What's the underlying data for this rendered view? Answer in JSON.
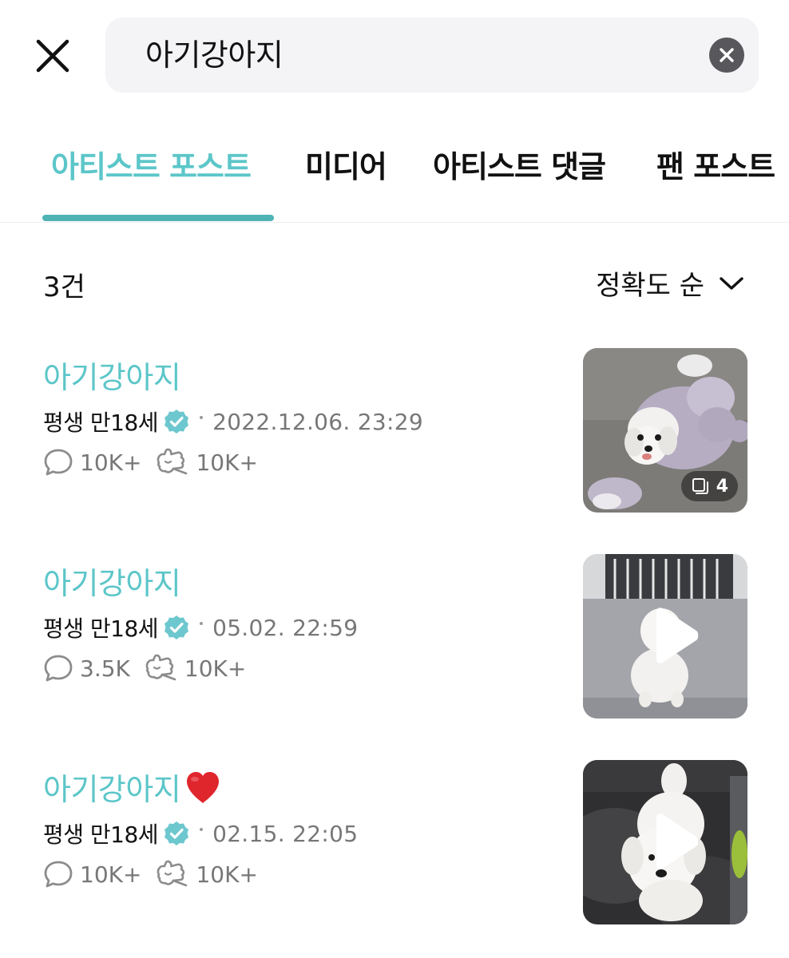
{
  "search": {
    "query": "아기강아지"
  },
  "tabs": [
    {
      "label": "아티스트 포스트",
      "active": true
    },
    {
      "label": "미디어",
      "active": false
    },
    {
      "label": "아티스트 댓글",
      "active": false
    },
    {
      "label": "팬 포스트",
      "active": false
    }
  ],
  "results": {
    "count_label": "3건",
    "sort_label": "정확도 순"
  },
  "posts": [
    {
      "title": "아기강아지",
      "author": "평생 만18세",
      "date": "2022.12.06. 23:29",
      "comments": "10K+",
      "likes": "10K+",
      "thumbnail": "photo of white dog in lavender hoodie",
      "media_count": "4"
    },
    {
      "title": "아기강아지",
      "author": "평생 만18세",
      "date": "05.02. 22:59",
      "comments": "3.5K",
      "likes": "10K+",
      "thumbnail": "video of white dog sitting on grey floor"
    },
    {
      "title": "아기강아지",
      "title_emoji": "heart",
      "author": "평생 만18세",
      "date": "02.15. 22:05",
      "comments": "10K+",
      "likes": "10K+",
      "thumbnail": "video of white dog on dark leather sofa"
    }
  ],
  "colors": {
    "accent": "#5cc6c9",
    "underline": "#4fb3b6",
    "verified": "#6dc7cf",
    "meta_gray": "#777777",
    "heart": "#e0262d"
  },
  "icons": {
    "close": "close-icon",
    "clear": "clear-icon",
    "sort": "chevron-down-icon",
    "verified": "verified-badge-icon",
    "comment": "comment-icon",
    "like": "like-icon",
    "multi": "multi-image-icon",
    "play": "play-icon"
  }
}
